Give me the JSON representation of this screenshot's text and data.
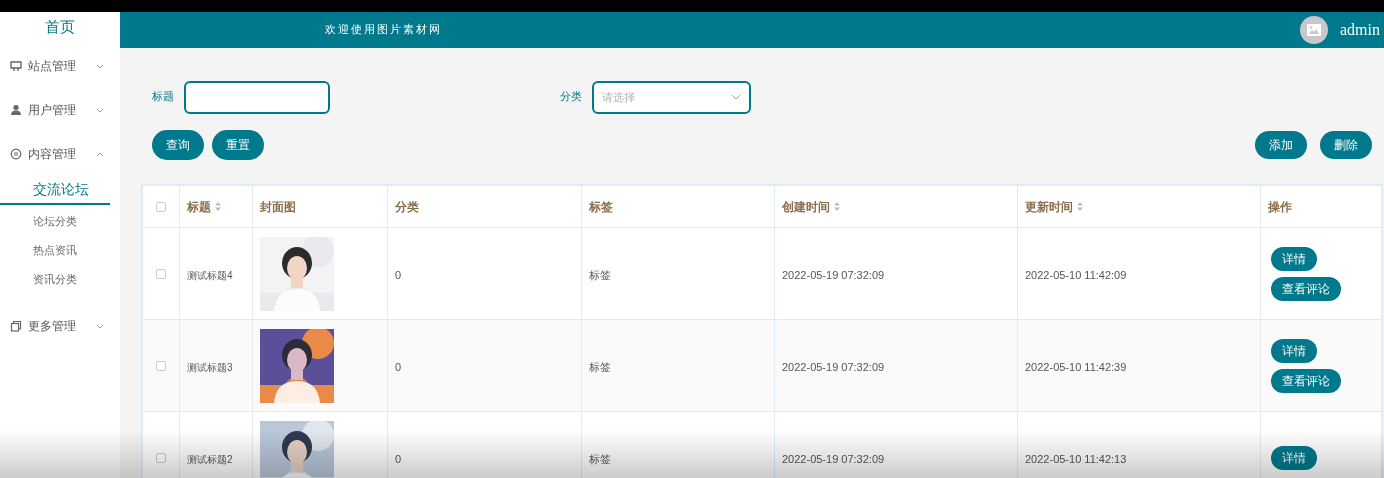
{
  "sidebar": {
    "home": "首页",
    "menus": [
      {
        "label": "站点管理",
        "expanded": false
      },
      {
        "label": "用户管理",
        "expanded": false
      },
      {
        "label": "内容管理",
        "expanded": true,
        "children": [
          {
            "label": "交流论坛",
            "selected": true
          },
          {
            "label": "论坛分类",
            "selected": false
          },
          {
            "label": "热点资讯",
            "selected": false
          },
          {
            "label": "资讯分类",
            "selected": false
          }
        ]
      },
      {
        "label": "更多管理",
        "expanded": false
      }
    ]
  },
  "header": {
    "title": "欢迎使用图片素材网",
    "user": "admin"
  },
  "search": {
    "title_label": "标题",
    "category_label": "分类",
    "category_placeholder": "请选择",
    "buttons": [
      "查询",
      "重置"
    ],
    "actions": [
      "添加",
      "删除"
    ]
  },
  "table": {
    "all_checked": false,
    "columns": [
      {
        "label": "标题",
        "sortable": true
      },
      {
        "label": "封面图",
        "sortable": false
      },
      {
        "label": "分类",
        "sortable": false
      },
      {
        "label": "标签",
        "sortable": false
      },
      {
        "label": "创建时间",
        "sortable": true
      },
      {
        "label": "更新时间",
        "sortable": true
      },
      {
        "label": "操作",
        "sortable": false
      }
    ],
    "rows": [
      {
        "checked": false,
        "title": "测试标题4",
        "cover": {
          "kind": "picture"
        },
        "category": "0",
        "tag": "标签",
        "created": "2022-05-19 07:32:09",
        "updated": "2022-05-10 11:42:09",
        "buttons": [
          "详情",
          "查看评论"
        ]
      },
      {
        "checked": false,
        "title": "测试标题3",
        "cover": {
          "kind": "picture"
        },
        "category": "0",
        "tag": "标签",
        "created": "2022-05-19 07:32:09",
        "updated": "2022-05-10 11:42:39",
        "buttons": [
          "详情",
          "查看评论"
        ]
      },
      {
        "checked": false,
        "title": "测试标题2",
        "cover": {
          "kind": "picture"
        },
        "category": "0",
        "tag": "标签",
        "created": "2022-05-19 07:32:09",
        "updated": "2022-05-10 11:42:13",
        "buttons": [
          "详情"
        ]
      }
    ]
  }
}
